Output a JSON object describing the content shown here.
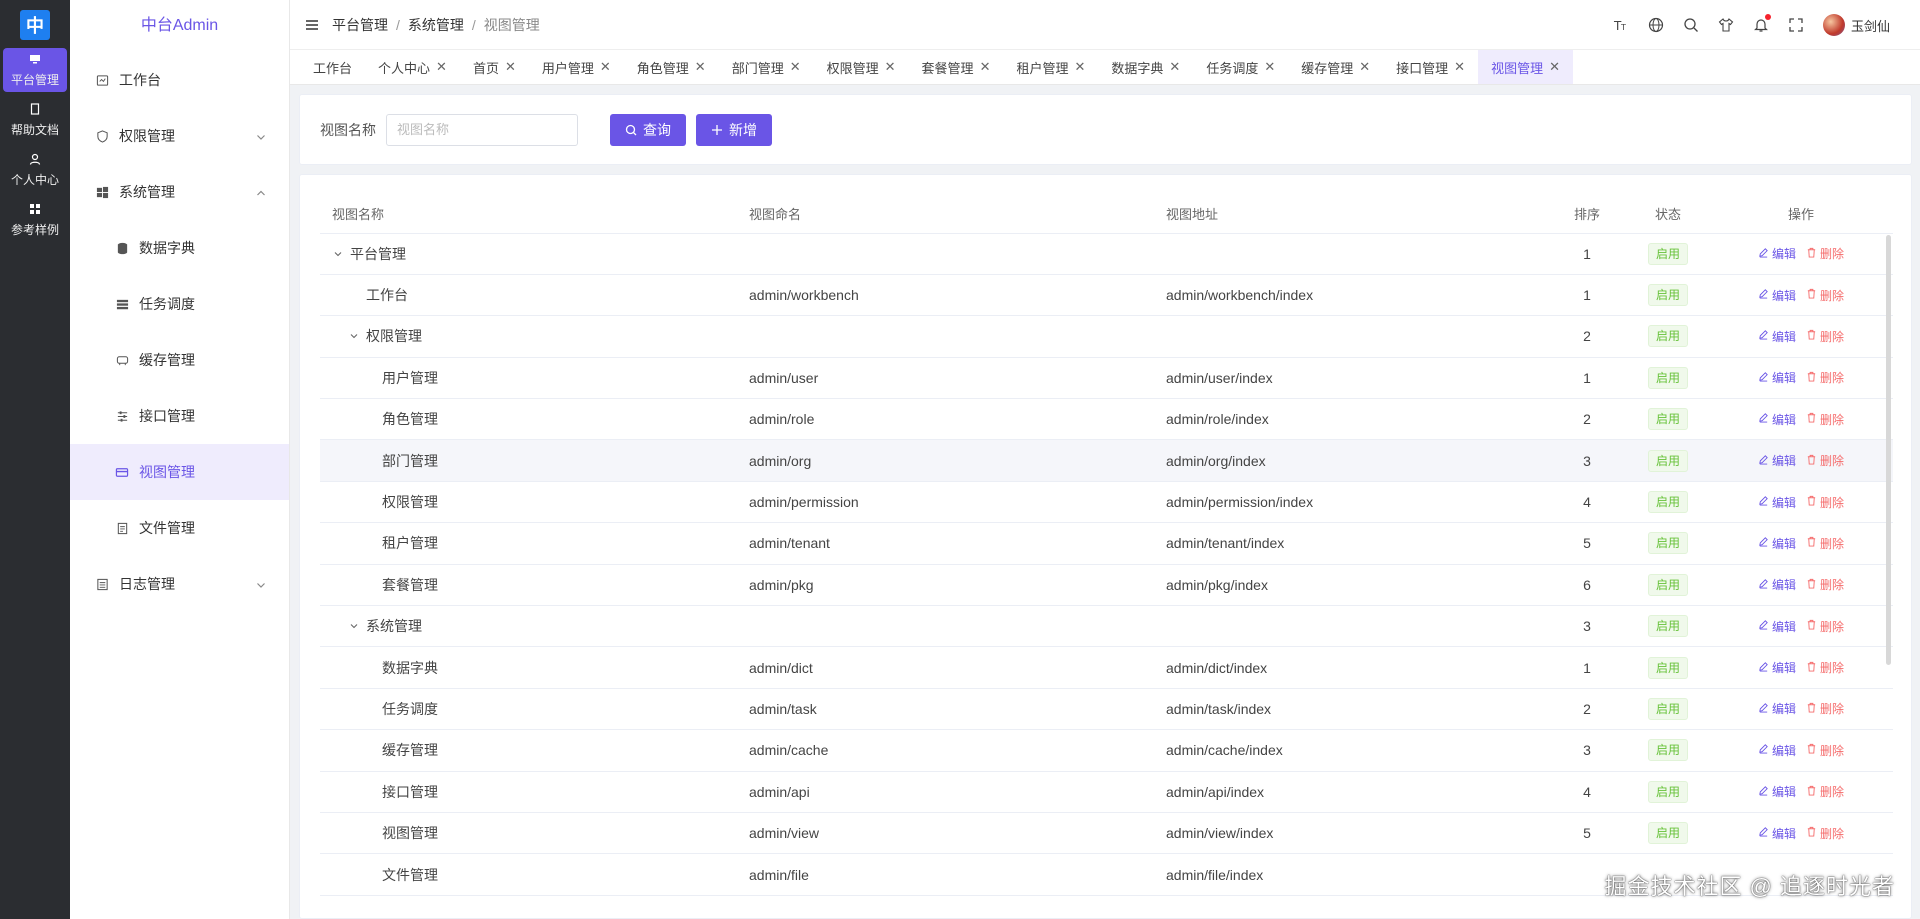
{
  "rail": {
    "logo": "中",
    "items": [
      {
        "label": "平台管理",
        "icon": "monitor-icon",
        "active": true
      },
      {
        "label": "帮助文档",
        "icon": "book-icon",
        "active": false
      },
      {
        "label": "个人中心",
        "icon": "user-icon",
        "active": false
      },
      {
        "label": "参考样例",
        "icon": "grid-icon",
        "active": false
      }
    ]
  },
  "sidebar": {
    "brand": "中台Admin",
    "items": [
      {
        "label": "工作台",
        "icon": "dashboard-icon"
      },
      {
        "label": "权限管理",
        "icon": "shield-icon",
        "chevron": "down"
      },
      {
        "label": "系统管理",
        "icon": "windows-icon",
        "chevron": "up"
      },
      {
        "label": "数据字典",
        "icon": "database-icon",
        "sub": true
      },
      {
        "label": "任务调度",
        "icon": "task-icon",
        "sub": true
      },
      {
        "label": "缓存管理",
        "icon": "cache-icon",
        "sub": true
      },
      {
        "label": "接口管理",
        "icon": "sliders-icon",
        "sub": true
      },
      {
        "label": "视图管理",
        "icon": "card-icon",
        "sub": true,
        "active": true
      },
      {
        "label": "文件管理",
        "icon": "file-icon",
        "sub": true
      },
      {
        "label": "日志管理",
        "icon": "log-icon",
        "chevron": "down"
      }
    ]
  },
  "header": {
    "breadcrumb": [
      "平台管理",
      "系统管理",
      "视图管理"
    ],
    "user_name": "玉剑仙",
    "icons": [
      "font-size-icon",
      "globe-icon",
      "search-icon",
      "shirt-icon",
      "bell-icon",
      "fullscreen-icon"
    ]
  },
  "tabs": [
    {
      "label": "工作台",
      "closable": false
    },
    {
      "label": "个人中心",
      "closable": true
    },
    {
      "label": "首页",
      "closable": true
    },
    {
      "label": "用户管理",
      "closable": true
    },
    {
      "label": "角色管理",
      "closable": true
    },
    {
      "label": "部门管理",
      "closable": true
    },
    {
      "label": "权限管理",
      "closable": true
    },
    {
      "label": "套餐管理",
      "closable": true
    },
    {
      "label": "租户管理",
      "closable": true
    },
    {
      "label": "数据字典",
      "closable": true
    },
    {
      "label": "任务调度",
      "closable": true
    },
    {
      "label": "缓存管理",
      "closable": true
    },
    {
      "label": "接口管理",
      "closable": true
    },
    {
      "label": "视图管理",
      "closable": true,
      "active": true
    }
  ],
  "search": {
    "label": "视图名称",
    "placeholder": "视图名称",
    "query_label": "查询",
    "add_label": "新增"
  },
  "table": {
    "columns": [
      "视图名称",
      "视图命名",
      "视图地址",
      "排序",
      "状态",
      "操作"
    ],
    "edit_label": "编辑",
    "delete_label": "删除",
    "rows": [
      {
        "name": "平台管理",
        "level": 0,
        "expand": true,
        "naming": "",
        "path": "",
        "sort": "1",
        "status": "启用"
      },
      {
        "name": "工作台",
        "level": 1,
        "expand": false,
        "naming": "admin/workbench",
        "path": "admin/workbench/index",
        "sort": "1",
        "status": "启用"
      },
      {
        "name": "权限管理",
        "level": 1,
        "expand": true,
        "naming": "",
        "path": "",
        "sort": "2",
        "status": "启用"
      },
      {
        "name": "用户管理",
        "level": 2,
        "expand": false,
        "naming": "admin/user",
        "path": "admin/user/index",
        "sort": "1",
        "status": "启用"
      },
      {
        "name": "角色管理",
        "level": 2,
        "expand": false,
        "naming": "admin/role",
        "path": "admin/role/index",
        "sort": "2",
        "status": "启用"
      },
      {
        "name": "部门管理",
        "level": 2,
        "expand": false,
        "naming": "admin/org",
        "path": "admin/org/index",
        "sort": "3",
        "status": "启用",
        "highlight": true
      },
      {
        "name": "权限管理",
        "level": 2,
        "expand": false,
        "naming": "admin/permission",
        "path": "admin/permission/index",
        "sort": "4",
        "status": "启用"
      },
      {
        "name": "租户管理",
        "level": 2,
        "expand": false,
        "naming": "admin/tenant",
        "path": "admin/tenant/index",
        "sort": "5",
        "status": "启用"
      },
      {
        "name": "套餐管理",
        "level": 2,
        "expand": false,
        "naming": "admin/pkg",
        "path": "admin/pkg/index",
        "sort": "6",
        "status": "启用"
      },
      {
        "name": "系统管理",
        "level": 1,
        "expand": true,
        "naming": "",
        "path": "",
        "sort": "3",
        "status": "启用"
      },
      {
        "name": "数据字典",
        "level": 2,
        "expand": false,
        "naming": "admin/dict",
        "path": "admin/dict/index",
        "sort": "1",
        "status": "启用"
      },
      {
        "name": "任务调度",
        "level": 2,
        "expand": false,
        "naming": "admin/task",
        "path": "admin/task/index",
        "sort": "2",
        "status": "启用"
      },
      {
        "name": "缓存管理",
        "level": 2,
        "expand": false,
        "naming": "admin/cache",
        "path": "admin/cache/index",
        "sort": "3",
        "status": "启用"
      },
      {
        "name": "接口管理",
        "level": 2,
        "expand": false,
        "naming": "admin/api",
        "path": "admin/api/index",
        "sort": "4",
        "status": "启用"
      },
      {
        "name": "视图管理",
        "level": 2,
        "expand": false,
        "naming": "admin/view",
        "path": "admin/view/index",
        "sort": "5",
        "status": "启用"
      },
      {
        "name": "文件管理",
        "level": 2,
        "expand": false,
        "naming": "admin/file",
        "path": "admin/file/index",
        "sort": "",
        "status": ""
      }
    ]
  },
  "watermark": "掘金技术社区 @ 追逐时光者",
  "colors": {
    "accent": "#6a55e6",
    "success": "#67c23a",
    "danger": "#f56c6c",
    "rail_bg": "#2b2d31"
  }
}
